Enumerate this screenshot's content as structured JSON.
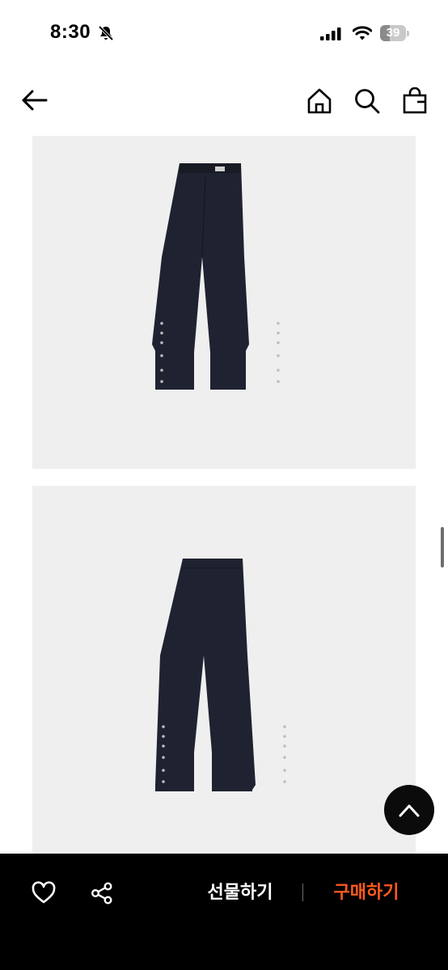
{
  "status_bar": {
    "time": "8:30",
    "battery_level": "39",
    "battery_fraction": 0.39
  },
  "nav_bar": {
    "icons": [
      "arrow-left-icon",
      "home-icon",
      "search-icon",
      "shopping-bag-icon"
    ]
  },
  "product_images": [
    {
      "view": "front"
    },
    {
      "view": "back"
    }
  ],
  "bottom_bar": {
    "gift_label": "선물하기",
    "buy_label": "구매하기",
    "buy_color": "#ff5a1f"
  },
  "colors": {
    "image_background": "#efefef",
    "garment": "#1f2230",
    "bottom_bar": "#000000"
  }
}
